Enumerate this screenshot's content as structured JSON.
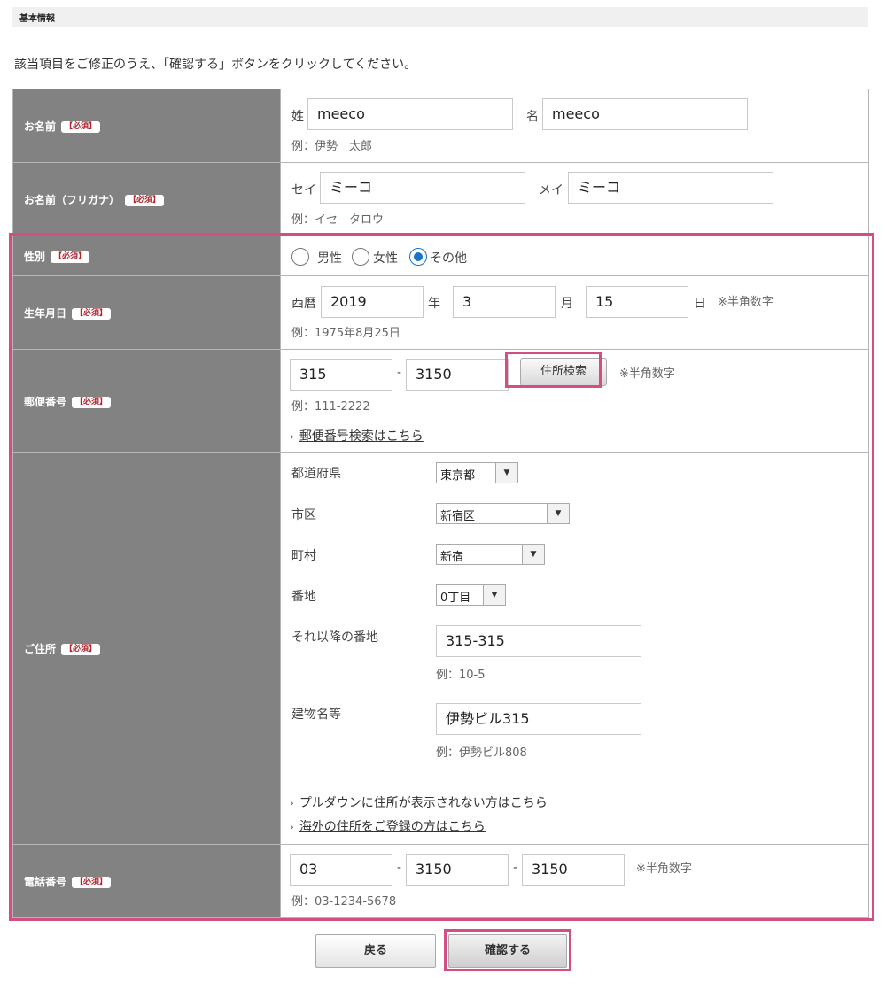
{
  "section": {
    "title": "基本情報"
  },
  "intro_text": "該当項目をご修正のうえ、「確認する」ボタンをクリックしてください。",
  "required_badge": "【必須】",
  "name": {
    "label": "お名前",
    "last_label": "姓",
    "last_value": "meeco",
    "first_label": "名",
    "first_value": "meeco",
    "example": "例：伊勢　太郎"
  },
  "kana": {
    "label": "お名前（フリガナ）",
    "last_label": "セイ",
    "last_value": "ミーコ",
    "first_label": "メイ",
    "first_value": "ミーコ",
    "example": "例：イセ　タロウ"
  },
  "gender": {
    "label": "性別",
    "options": [
      "男性",
      "女性",
      "その他"
    ],
    "selected": "その他"
  },
  "birth": {
    "label": "生年月日",
    "era_label": "西暦",
    "year": "2019",
    "year_unit": "年",
    "month": "3",
    "month_unit": "月",
    "day": "15",
    "day_unit": "日",
    "note": "※半角数字",
    "example": "例：1975年8月25日"
  },
  "postal": {
    "label": "郵便番号",
    "part1": "315",
    "separator": "-",
    "part2": "3150",
    "search_button": "住所検索",
    "note": "※半角数字",
    "example": "例：111-2222",
    "link": "郵便番号検索はこちら"
  },
  "address": {
    "label": "ご住所",
    "prefecture_label": "都道府県",
    "prefecture_value": "東京都",
    "city_label": "市区",
    "city_value": "新宿区",
    "town_label": "町村",
    "town_value": "新宿",
    "block_label": "番地",
    "block_value": "0丁目",
    "after_label": "それ以降の番地",
    "after_value": "315-315",
    "after_example": "例：10-5",
    "building_label": "建物名等",
    "building_value": "伊勢ビル315",
    "building_example": "例：伊勢ビル808",
    "link1": "プルダウンに住所が表示されない方はこちら",
    "link2": "海外の住所をご登録の方はこちら"
  },
  "phone": {
    "label": "電話番号",
    "part1": "03",
    "separator": "-",
    "part2": "3150",
    "part3": "3150",
    "note": "※半角数字",
    "example": "例：03-1234-5678"
  },
  "buttons": {
    "back": "戻る",
    "confirm": "確認する"
  },
  "colors": {
    "highlight": "#d24f83",
    "label_bg": "#828282",
    "required": "#b0242e",
    "radio_selected": "#1a73c6"
  }
}
